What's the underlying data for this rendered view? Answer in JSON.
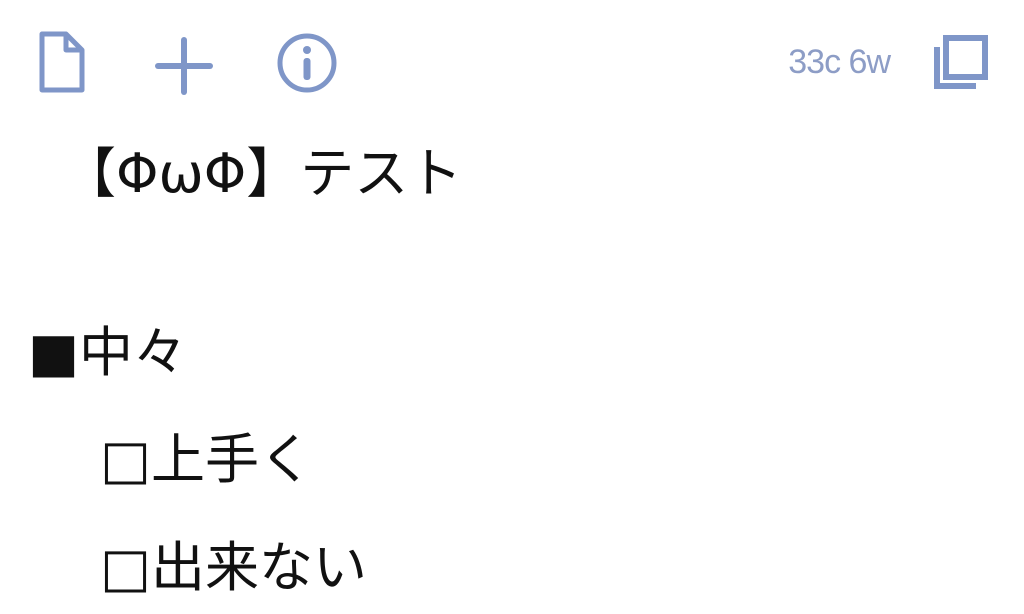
{
  "toolbar": {
    "icons": {
      "new_document": "document-icon",
      "add": "plus-icon",
      "info": "info-icon",
      "expand": "expand-icon"
    },
    "counter": "33c 6w",
    "accent_color": "#7f96c8"
  },
  "editor": {
    "lines": [
      "【ΦωΦ】テスト",
      "",
      "■中々",
      "□上手く",
      "□出来ない"
    ]
  }
}
